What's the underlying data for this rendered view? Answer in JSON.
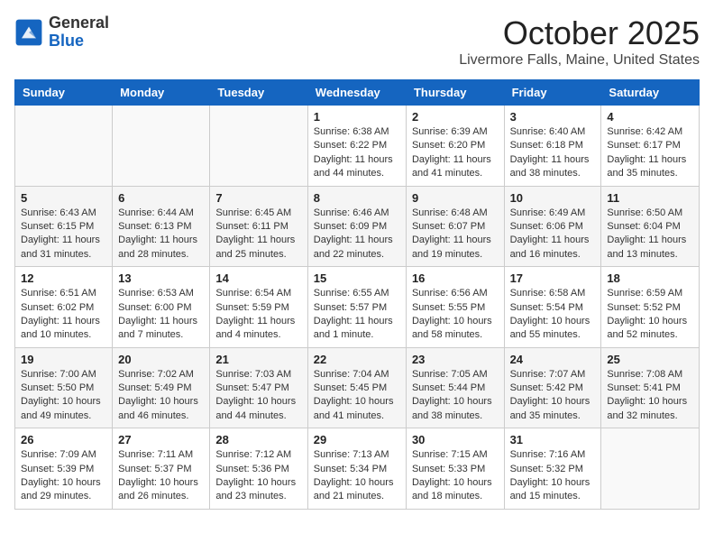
{
  "header": {
    "logo_general": "General",
    "logo_blue": "Blue",
    "month_title": "October 2025",
    "location": "Livermore Falls, Maine, United States"
  },
  "weekdays": [
    "Sunday",
    "Monday",
    "Tuesday",
    "Wednesday",
    "Thursday",
    "Friday",
    "Saturday"
  ],
  "weeks": [
    [
      {
        "day": "",
        "content": ""
      },
      {
        "day": "",
        "content": ""
      },
      {
        "day": "",
        "content": ""
      },
      {
        "day": "1",
        "content": "Sunrise: 6:38 AM\nSunset: 6:22 PM\nDaylight: 11 hours\nand 44 minutes."
      },
      {
        "day": "2",
        "content": "Sunrise: 6:39 AM\nSunset: 6:20 PM\nDaylight: 11 hours\nand 41 minutes."
      },
      {
        "day": "3",
        "content": "Sunrise: 6:40 AM\nSunset: 6:18 PM\nDaylight: 11 hours\nand 38 minutes."
      },
      {
        "day": "4",
        "content": "Sunrise: 6:42 AM\nSunset: 6:17 PM\nDaylight: 11 hours\nand 35 minutes."
      }
    ],
    [
      {
        "day": "5",
        "content": "Sunrise: 6:43 AM\nSunset: 6:15 PM\nDaylight: 11 hours\nand 31 minutes."
      },
      {
        "day": "6",
        "content": "Sunrise: 6:44 AM\nSunset: 6:13 PM\nDaylight: 11 hours\nand 28 minutes."
      },
      {
        "day": "7",
        "content": "Sunrise: 6:45 AM\nSunset: 6:11 PM\nDaylight: 11 hours\nand 25 minutes."
      },
      {
        "day": "8",
        "content": "Sunrise: 6:46 AM\nSunset: 6:09 PM\nDaylight: 11 hours\nand 22 minutes."
      },
      {
        "day": "9",
        "content": "Sunrise: 6:48 AM\nSunset: 6:07 PM\nDaylight: 11 hours\nand 19 minutes."
      },
      {
        "day": "10",
        "content": "Sunrise: 6:49 AM\nSunset: 6:06 PM\nDaylight: 11 hours\nand 16 minutes."
      },
      {
        "day": "11",
        "content": "Sunrise: 6:50 AM\nSunset: 6:04 PM\nDaylight: 11 hours\nand 13 minutes."
      }
    ],
    [
      {
        "day": "12",
        "content": "Sunrise: 6:51 AM\nSunset: 6:02 PM\nDaylight: 11 hours\nand 10 minutes."
      },
      {
        "day": "13",
        "content": "Sunrise: 6:53 AM\nSunset: 6:00 PM\nDaylight: 11 hours\nand 7 minutes."
      },
      {
        "day": "14",
        "content": "Sunrise: 6:54 AM\nSunset: 5:59 PM\nDaylight: 11 hours\nand 4 minutes."
      },
      {
        "day": "15",
        "content": "Sunrise: 6:55 AM\nSunset: 5:57 PM\nDaylight: 11 hours\nand 1 minute."
      },
      {
        "day": "16",
        "content": "Sunrise: 6:56 AM\nSunset: 5:55 PM\nDaylight: 10 hours\nand 58 minutes."
      },
      {
        "day": "17",
        "content": "Sunrise: 6:58 AM\nSunset: 5:54 PM\nDaylight: 10 hours\nand 55 minutes."
      },
      {
        "day": "18",
        "content": "Sunrise: 6:59 AM\nSunset: 5:52 PM\nDaylight: 10 hours\nand 52 minutes."
      }
    ],
    [
      {
        "day": "19",
        "content": "Sunrise: 7:00 AM\nSunset: 5:50 PM\nDaylight: 10 hours\nand 49 minutes."
      },
      {
        "day": "20",
        "content": "Sunrise: 7:02 AM\nSunset: 5:49 PM\nDaylight: 10 hours\nand 46 minutes."
      },
      {
        "day": "21",
        "content": "Sunrise: 7:03 AM\nSunset: 5:47 PM\nDaylight: 10 hours\nand 44 minutes."
      },
      {
        "day": "22",
        "content": "Sunrise: 7:04 AM\nSunset: 5:45 PM\nDaylight: 10 hours\nand 41 minutes."
      },
      {
        "day": "23",
        "content": "Sunrise: 7:05 AM\nSunset: 5:44 PM\nDaylight: 10 hours\nand 38 minutes."
      },
      {
        "day": "24",
        "content": "Sunrise: 7:07 AM\nSunset: 5:42 PM\nDaylight: 10 hours\nand 35 minutes."
      },
      {
        "day": "25",
        "content": "Sunrise: 7:08 AM\nSunset: 5:41 PM\nDaylight: 10 hours\nand 32 minutes."
      }
    ],
    [
      {
        "day": "26",
        "content": "Sunrise: 7:09 AM\nSunset: 5:39 PM\nDaylight: 10 hours\nand 29 minutes."
      },
      {
        "day": "27",
        "content": "Sunrise: 7:11 AM\nSunset: 5:37 PM\nDaylight: 10 hours\nand 26 minutes."
      },
      {
        "day": "28",
        "content": "Sunrise: 7:12 AM\nSunset: 5:36 PM\nDaylight: 10 hours\nand 23 minutes."
      },
      {
        "day": "29",
        "content": "Sunrise: 7:13 AM\nSunset: 5:34 PM\nDaylight: 10 hours\nand 21 minutes."
      },
      {
        "day": "30",
        "content": "Sunrise: 7:15 AM\nSunset: 5:33 PM\nDaylight: 10 hours\nand 18 minutes."
      },
      {
        "day": "31",
        "content": "Sunrise: 7:16 AM\nSunset: 5:32 PM\nDaylight: 10 hours\nand 15 minutes."
      },
      {
        "day": "",
        "content": ""
      }
    ]
  ]
}
